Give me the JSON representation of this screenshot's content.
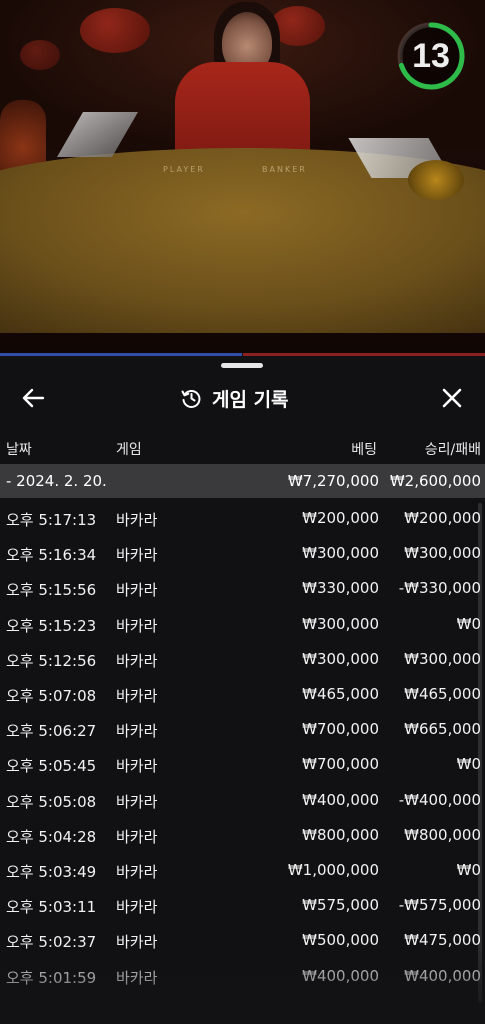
{
  "video": {
    "table_labels": [
      "PLAYER",
      "BANKER"
    ]
  },
  "timer": {
    "value": "13",
    "progress": 0.7,
    "color": "#2dbb4a"
  },
  "panel": {
    "back_icon": "arrow-left-icon",
    "history_icon": "history-clock-icon",
    "close_icon": "close-icon",
    "title": "게임 기록"
  },
  "columns": {
    "date": "날짜",
    "game": "게임",
    "bet": "베팅",
    "result": "승리/패배"
  },
  "date_group": {
    "date": "- 2024. 2. 20.",
    "bet_total": "₩7,270,000",
    "result_total": "₩2,600,000"
  },
  "rows": [
    {
      "time": "오후 5:17:13",
      "game": "바카라",
      "bet": "₩200,000",
      "result": "₩200,000"
    },
    {
      "time": "오후 5:16:34",
      "game": "바카라",
      "bet": "₩300,000",
      "result": "₩300,000"
    },
    {
      "time": "오후 5:15:56",
      "game": "바카라",
      "bet": "₩330,000",
      "result": "-₩330,000"
    },
    {
      "time": "오후 5:15:23",
      "game": "바카라",
      "bet": "₩300,000",
      "result": "₩0"
    },
    {
      "time": "오후 5:12:56",
      "game": "바카라",
      "bet": "₩300,000",
      "result": "₩300,000"
    },
    {
      "time": "오후 5:07:08",
      "game": "바카라",
      "bet": "₩465,000",
      "result": "₩465,000"
    },
    {
      "time": "오후 5:06:27",
      "game": "바카라",
      "bet": "₩700,000",
      "result": "₩665,000"
    },
    {
      "time": "오후 5:05:45",
      "game": "바카라",
      "bet": "₩700,000",
      "result": "₩0"
    },
    {
      "time": "오후 5:05:08",
      "game": "바카라",
      "bet": "₩400,000",
      "result": "-₩400,000"
    },
    {
      "time": "오후 5:04:28",
      "game": "바카라",
      "bet": "₩800,000",
      "result": "₩800,000"
    },
    {
      "time": "오후 5:03:49",
      "game": "바카라",
      "bet": "₩1,000,000",
      "result": "₩0"
    },
    {
      "time": "오후 5:03:11",
      "game": "바카라",
      "bet": "₩575,000",
      "result": "-₩575,000"
    },
    {
      "time": "오후 5:02:37",
      "game": "바카라",
      "bet": "₩500,000",
      "result": "₩475,000"
    },
    {
      "time": "오후 5:01:59",
      "game": "바카라",
      "bet": "₩400,000",
      "result": "₩400,000"
    }
  ]
}
